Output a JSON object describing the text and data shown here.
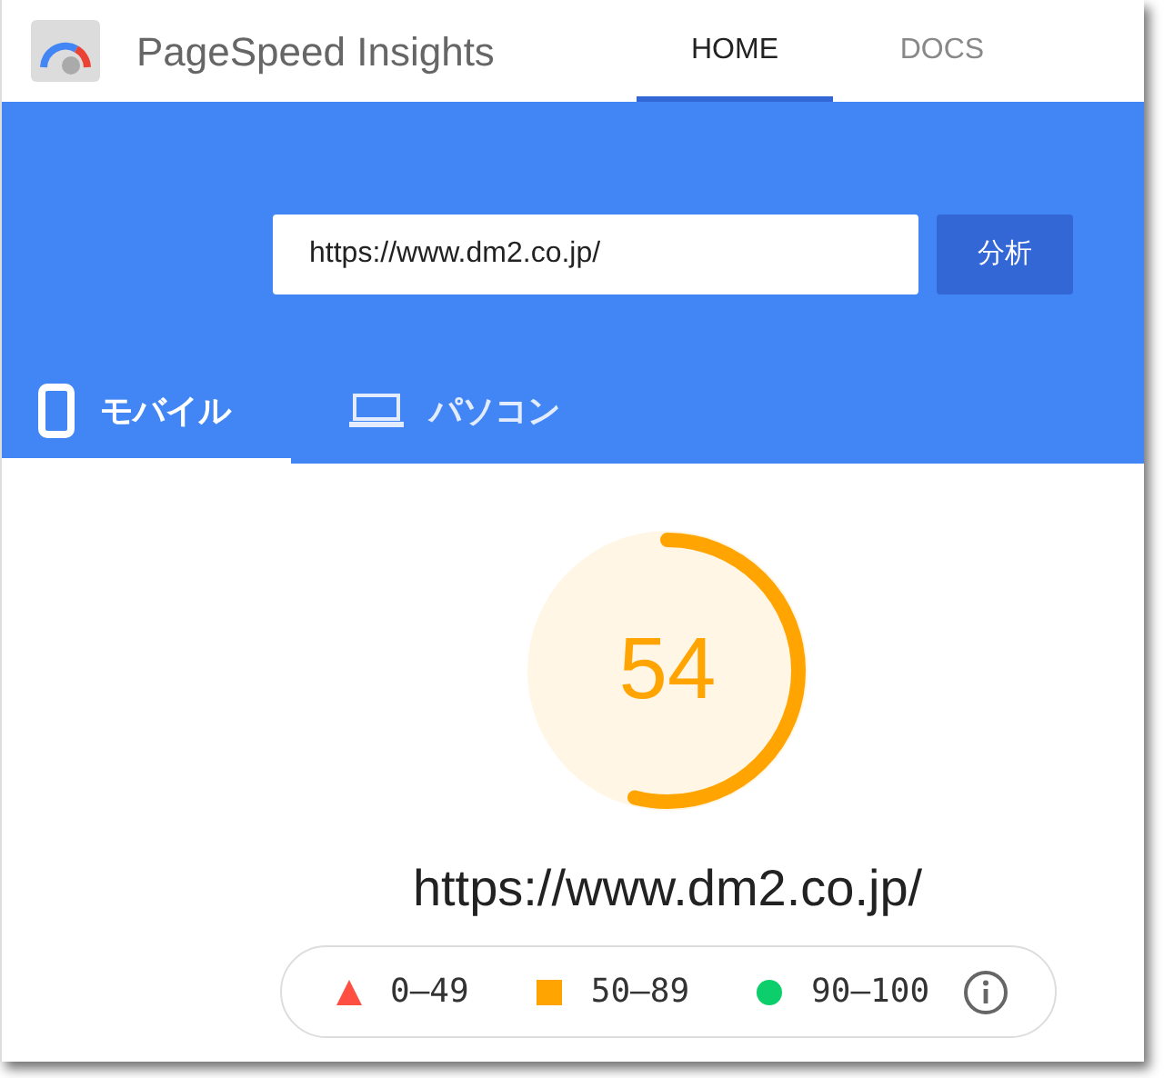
{
  "header": {
    "title": "PageSpeed Insights",
    "nav": [
      {
        "label": "HOME",
        "selected": true
      },
      {
        "label": "DOCS",
        "selected": false
      }
    ]
  },
  "search": {
    "value": "https://www.dm2.co.jp/",
    "button": "分析"
  },
  "device_tabs": [
    {
      "label": "モバイル",
      "kind": "phone",
      "selected": true
    },
    {
      "label": "パソコン",
      "kind": "laptop",
      "selected": false
    }
  ],
  "score": {
    "value": "54",
    "level": 0.54,
    "color": "#ffa400"
  },
  "url": "https://www.dm2.co.jp/",
  "legend": [
    {
      "kind": "triangle",
      "label": "0–49",
      "color": "#ff4e42"
    },
    {
      "kind": "square",
      "label": "50–89",
      "color": "#ffa400"
    },
    {
      "kind": "circle",
      "label": "90–100",
      "color": "#0cce6b"
    }
  ]
}
